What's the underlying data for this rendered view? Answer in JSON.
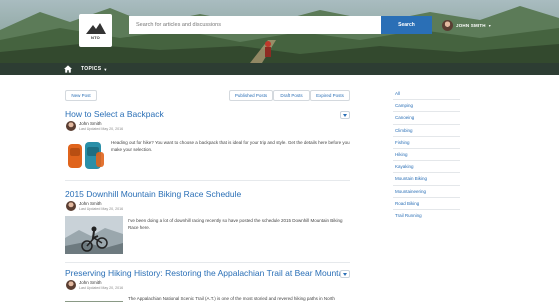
{
  "header": {
    "logo_text": "NTO",
    "search_placeholder": "Search for articles and discussions",
    "search_button": "Search",
    "user_name": "JOHN SMITH"
  },
  "nav": {
    "topics_label": "TOPICS"
  },
  "toolbar": {
    "new_post": "New Post",
    "published_posts": "Published Posts",
    "draft_posts": "Draft Posts",
    "expired_posts": "Expired Posts"
  },
  "posts": [
    {
      "title": "How to Select a Backpack",
      "author": "John Smith",
      "updated": "Last Updated May 20, 2016",
      "excerpt": "Heading out for hike? You want to choose a backpack that is ideal for your trip and style. Get the details here before you make your selection."
    },
    {
      "title": "2015 Downhill Mountain Biking Race Schedule",
      "author": "John Smith",
      "updated": "Last Updated May 20, 2016",
      "excerpt": "I've been doing a lot of downhill racing recently so have posted the schedule 2015 Downhill Mountain Biking Race here."
    },
    {
      "title": "Preserving Hiking History: Restoring the Appalachian Trail at Bear Mountain",
      "author": "John Smith",
      "updated": "Last Updated May 20, 2016",
      "excerpt": "The Appalachian National Scenic Trail (A.T.) is one of the most storied and revered hiking paths in North"
    }
  ],
  "sidebar": {
    "topics": [
      "All",
      "Camping",
      "Canoeing",
      "Climbing",
      "Fishing",
      "Hiking",
      "Kayaking",
      "Mountain Biking",
      "Mountaineering",
      "Road Biking",
      "Trail Running"
    ]
  },
  "colors": {
    "accent": "#2a6fb6",
    "nav_bg": "#2d3d33"
  }
}
